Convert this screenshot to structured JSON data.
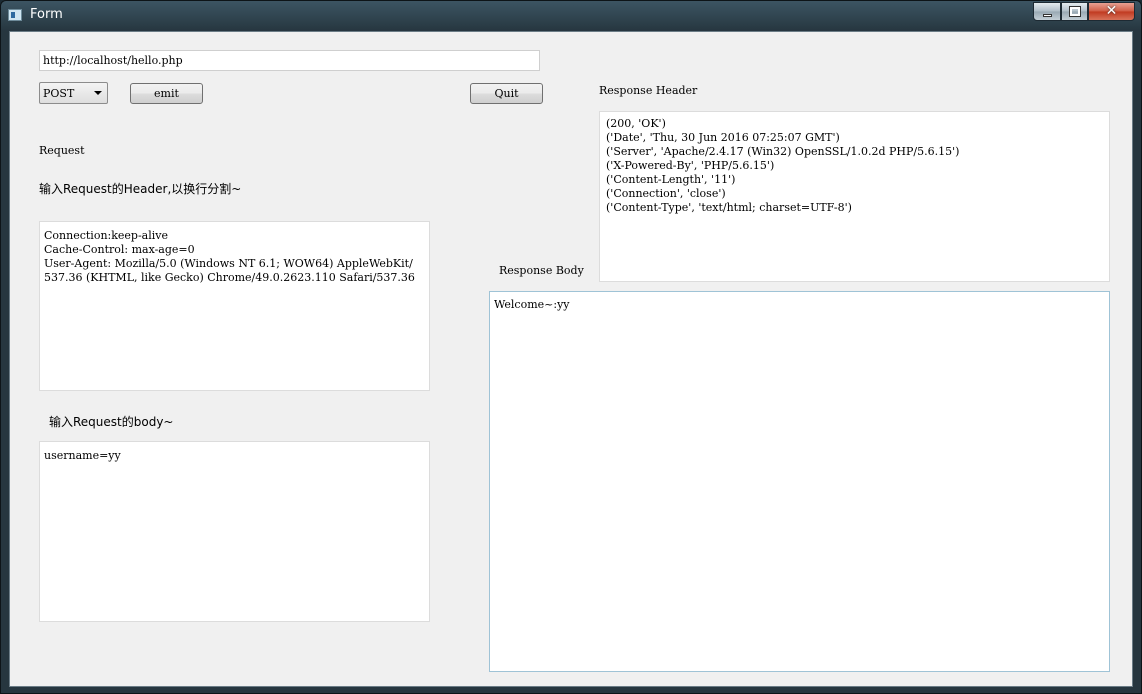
{
  "window": {
    "title": "Form",
    "close_glyph": "✕"
  },
  "form": {
    "url_value": "http://localhost/hello.php",
    "method_selected": "POST",
    "emit_label": "emit",
    "quit_label": "Quit"
  },
  "request": {
    "section_label": "Request",
    "header_hint": "输入Request的Header,以换行分割~",
    "header_text": "Connection:keep-alive\nCache-Control: max-age=0\nUser-Agent: Mozilla/5.0 (Windows NT 6.1; WOW64) AppleWebKit/\n537.36 (KHTML, like Gecko) Chrome/49.0.2623.110 Safari/537.36",
    "body_hint": "输入Request的body~",
    "body_text": "username=yy"
  },
  "response": {
    "header_label": "Response Header",
    "header_text": "(200, 'OK')\n('Date', 'Thu, 30 Jun 2016 07:25:07 GMT')\n('Server', 'Apache/2.4.17 (Win32) OpenSSL/1.0.2d PHP/5.6.15')\n('X-Powered-By', 'PHP/5.6.15')\n('Content-Length', '11')\n('Connection', 'close')\n('Content-Type', 'text/html; charset=UTF-8')",
    "body_label": "Response Body",
    "body_text": "Welcome~:yy"
  }
}
